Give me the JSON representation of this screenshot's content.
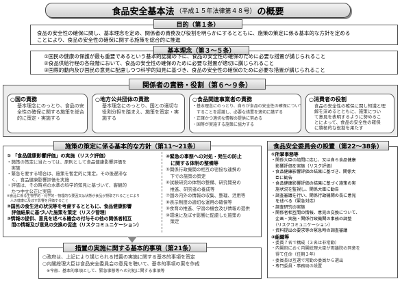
{
  "title": {
    "main": "食品安全基本法",
    "sub": "（平成１５年法律第４８号）",
    "suffix": "の概要"
  },
  "purpose": {
    "heading": "目的（第１条）",
    "lines": [
      "食品の安全性の確保に関し、基本理念を定め、関係者の責務及び役割を明らかにするとともに、施策の策定に係る基本的な方針を定める",
      "ことにより、食品の安全性の確保に関する施策を総合的に推進"
    ]
  },
  "principles": {
    "heading": "基本理念（第３～５条）",
    "lines": [
      "①国民の健康の保護が最も重要であるという基本的認識の下に、食品の安全性の確保のために必要な措置が講じられること",
      "②食品供給行程の各段階において、食品の安全性の確保のために必要な措置が適切に講じられること",
      "③国際的動向及び国民の意見に配慮しつつ科学的知見に基づき、食品の安全性の確保のために必要な措置が講じられること"
    ]
  },
  "duties": {
    "heading": "関係者の責務・役割（第６～９条）",
    "boxes": [
      {
        "title": "○国の責務",
        "lines": [
          "基本理念にのっとり、食品の安",
          "全性の確保に関する施策を総合",
          "的に策定・実施する"
        ]
      },
      {
        "title": "○地方公共団体の責務",
        "lines": [
          "基本理念にのっとり、国との適切な",
          "役割分担を踏まえ、施策を策定・実",
          "施する"
        ]
      },
      {
        "title": "○食品関連事業者の責務",
        "lines": [
          "・基本理念にのっとり、自らが食品の安全性の確保について一義的な責任を有",
          "　することを認識し、必要な措置を適切に講ずる",
          "・正確かつ適切な情報の提供に努める",
          "・国等が実施する施策に協力する"
        ]
      },
      {
        "title": "○消費者の役割",
        "lines": [
          "食品の安全性の確保に関し知識と理",
          "解を深めるとともに、施策につい",
          "て意見を表明するように努めるこ",
          "とによって、食品の安全性の確保",
          "に積極的な役割を果たす"
        ]
      }
    ]
  },
  "policy": {
    "heading": "施策の策定に係る基本的な方針（第11～21条）",
    "left": [
      "① 「食品健康影響評価」の実施（リスク評価）",
      "・施策の策定に当たっては、原則として食品健康影響評価を",
      "　実施",
      "・緊急を要する場合は、施策を暫定的に策定。その後遅滞な",
      "　く、食品健康影響評価を実施",
      "・評価は、その時点の水準の科学的知見に基づいて、客観的",
      "　かつ中立公正に実施",
      "※食品に係る生物学的・化学的・物理的な要因又は状態が食品が摂取されることにより",
      "　人の健康に及ぼす影響を評価すること",
      "②国民の食生活の状況等を考慮するとともに、食品健康影響",
      "　評価結果に基づいた施策を策定（リスク管理）",
      "③情報の提供、意見を述べる機会の付与その他の関係者相互",
      "　間の情報及び意見の交換の促進（リスクコミュニケーション）"
    ],
    "right": [
      "④緊急の事態への対処・発生の防止",
      "　に関する体制の整備等",
      "⑤関係行政機関の相互の密接な連携の",
      "　下での施策の策定",
      "⑥試験研究の体制の整備、研究開発の",
      "　推進、研究者の養成等",
      "⑦国の内外の情報の収集、整理、活用等",
      "⑧表示制度の適切な運用の確保等",
      "⑨食育の推進、学習の機会及び情報の提供",
      "⑩環境に及ぼす影響に配慮した施策の",
      "　策定"
    ]
  },
  "measures": {
    "heading": "措置の実施に関する基本的事項（第21条）",
    "lines": [
      "○政府は、上記により講じられる措置の実施に関する基本的事項を策定",
      "○内閣総理大臣は食品安全委員会の意見を聴いて、基本的事項の案を作成",
      "　※今般、基本的事項として、緊急事態等への対処に関する事項等"
    ]
  },
  "committee": {
    "heading": "食品安全委員会の設置（第22～38条）",
    "lines": [
      "①所掌事務等",
      "・関係大臣の諮問に応じ、又は自ら食品健康",
      "　影響評価を実施（リスク評価）",
      "・食品健康影響評価の結果に基づき、関係大",
      "　臣に勧告",
      "・食品健康影響評価の結果に基づく施策の実",
      "　施状況を監視し、関係大臣に勧告",
      "・調査審議を行い、関係行政機関の長に意見",
      "　を述べる（緊急対応）",
      "・調査研究の実施",
      "・関係者相互間の情報、意見の交換について、",
      "　企画・実施・関係行政機関の事務の調整",
      "　（リスクコミュニケーション）",
      "・資料提出の要求等の緊急時の調査審議",
      "②組織等",
      "・委員７名で構成（３名は非常勤）",
      "・内閣府におく内閣総理大臣が両議院の同意を",
      "　得て任命（任期３年）",
      "・委員長は互選で常勤の委員から選出",
      "・専門委員・事務局の設置"
    ]
  }
}
